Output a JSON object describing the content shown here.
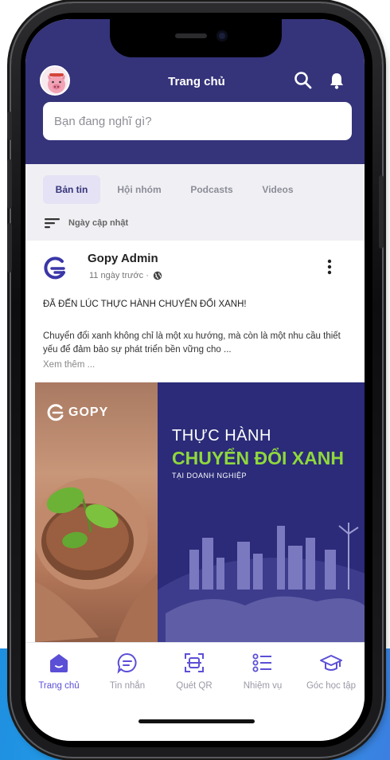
{
  "header": {
    "title": "Trang chủ"
  },
  "composer": {
    "placeholder": "Bạn đang nghĩ gì?"
  },
  "feed_tabs": [
    {
      "label": "Bản tin",
      "active": true
    },
    {
      "label": "Hội nhóm",
      "active": false
    },
    {
      "label": "Podcasts",
      "active": false
    },
    {
      "label": "Videos",
      "active": false
    }
  ],
  "sort": {
    "label": "Ngày cập nhật"
  },
  "post": {
    "author": "Gopy Admin",
    "time": "11 ngày trước ·",
    "heading": "ĐÃ ĐẾN LÚC THỰC HÀNH CHUYỂN ĐỔI XANH!",
    "body": "Chuyển đổi xanh không chỉ là một xu hướng, mà còn là một nhu cầu thiết yếu để đảm bảo sự phát triển bền vững cho ...",
    "see_more": "Xem thêm ...",
    "banner": {
      "brand": "GOPY",
      "title_line1": "THỰC HÀNH",
      "title_line2": "CHUYỂN ĐỔI XANH",
      "subtitle": "TẠI DOANH NGHIỆP"
    }
  },
  "tabbar": [
    {
      "label": "Trang chủ",
      "icon": "home-icon",
      "active": true
    },
    {
      "label": "Tin nhắn",
      "icon": "chat-icon",
      "active": false
    },
    {
      "label": "Quét QR",
      "icon": "qr-scan-icon",
      "active": false
    },
    {
      "label": "Nhiệm vụ",
      "icon": "task-list-icon",
      "active": false
    },
    {
      "label": "Góc học tập",
      "icon": "graduation-cap-icon",
      "active": false
    }
  ],
  "colors": {
    "header": "#35337a",
    "accent": "#5b4fd6",
    "banner_green": "#8fd83c"
  }
}
